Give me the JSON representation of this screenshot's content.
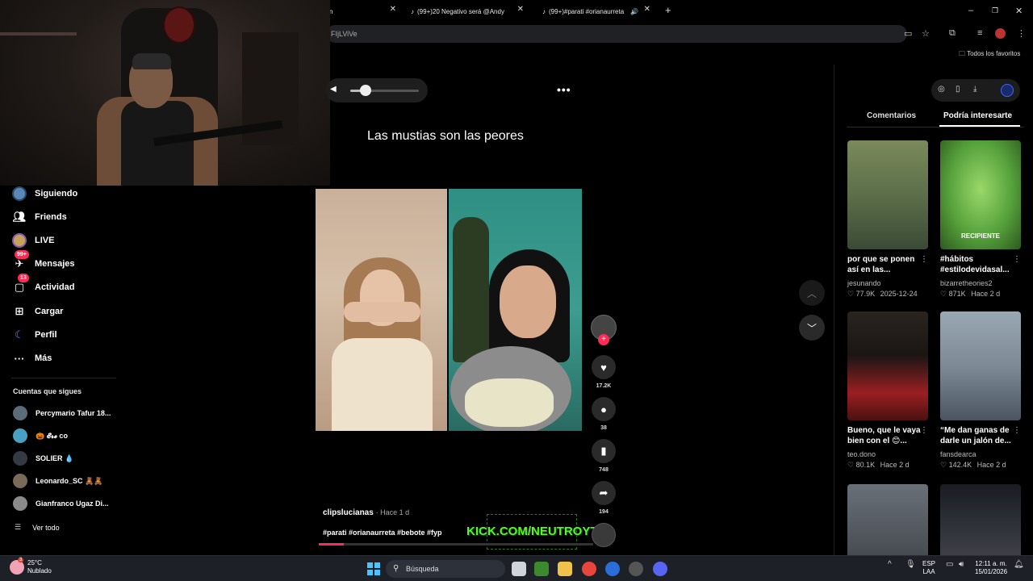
{
  "browser": {
    "tabs": [
      {
        "label": "n",
        "close": "✕"
      },
      {
        "label": "(99+)20 Negativo será @Andy",
        "close": "✕",
        "icon": "tiktok-icon"
      },
      {
        "label": "(99+)#parati #orianaurreta",
        "close": "✕",
        "icon": "tiktok-icon",
        "audio": "🔊"
      }
    ],
    "new_tab": "+",
    "url": "FIjLViVe",
    "bookmarks_label": "Todos los favoritos"
  },
  "sidebar": {
    "items": [
      {
        "label": "Siguiendo",
        "icon": "following-avatar-icon"
      },
      {
        "label": "Friends",
        "icon": "friends-icon"
      },
      {
        "label": "LIVE",
        "icon": "live-icon"
      },
      {
        "label": "Mensajes",
        "icon": "messages-icon",
        "badge": "99+"
      },
      {
        "label": "Actividad",
        "icon": "activity-icon",
        "badge": "13"
      },
      {
        "label": "Cargar",
        "icon": "upload-icon"
      },
      {
        "label": "Perfil",
        "icon": "profile-icon"
      },
      {
        "label": "Más",
        "icon": "more-icon"
      }
    ],
    "following_title": "Cuentas que sigues",
    "following": [
      {
        "name": "Percymario Tafur 18...",
        "color": "#5b6b7a"
      },
      {
        "name": "🎃 𝓔𝓻𝓮 co",
        "color": "#4aa0c0"
      },
      {
        "name": "SOLIER 💧",
        "color": "#333a44"
      },
      {
        "name": "Leonardo_SC 🧸🧸",
        "color": "#7a6a5a"
      },
      {
        "name": "Gianfranco Ugaz Di...",
        "color": "#8a8a8a"
      }
    ],
    "see_all": "Ver todo"
  },
  "video": {
    "caption": "Las mustias son las peores",
    "volume_fraction": 0.22,
    "more": "•••",
    "author": "clipslucianas",
    "time_ago": "· Hace 1 d",
    "hashtags": "#parati #orianaurreta #bebote #fyp",
    "progress_fraction": 0.09,
    "overlay_text": "KICK.COM/NEUTROYT",
    "actions": {
      "likes": "17.2K",
      "comments": "38",
      "saves": "748",
      "shares": "194"
    }
  },
  "panel": {
    "tab_comments": "Comentarios",
    "tab_related": "Podría interesarte",
    "cards": [
      {
        "title": "por que se ponen así en las...",
        "author": "jesunando",
        "likes": "♡ 77.9K",
        "date": "2025-12-24",
        "thumb": "#5c6f4a"
      },
      {
        "title": "#hábitos #estilodevidasal...",
        "author": "bizarretheories2",
        "likes": "♡ 871K",
        "date": "Hace 2 d",
        "thumb": "#57a23c",
        "label": "RECIPIENTE"
      },
      {
        "title": "Bueno, que le vaya bien con el 😊...",
        "author": "teo.dono",
        "likes": "♡ 80.1K",
        "date": "Hace 2 d",
        "thumb": "#9a1f22"
      },
      {
        "title": "“Me dan ganas de darle un jalón de...",
        "author": "fansdearca",
        "likes": "♡ 142.4K",
        "date": "Hace 2 d",
        "thumb": "#7d8a96"
      },
      {
        "title": "",
        "author": "",
        "likes": "",
        "date": "",
        "thumb": "#4a4f55"
      },
      {
        "title": "",
        "author": "",
        "likes": "",
        "date": "",
        "thumb": "#3a3d44"
      }
    ]
  },
  "taskbar": {
    "weather_temp": "25°C",
    "weather_desc": "Nublado",
    "weather_badge": "3",
    "search_placeholder": "Búsqueda",
    "lang_1": "ESP",
    "lang_2": "LAA",
    "time": "12:11 a. m.",
    "date": "15/01/2026"
  },
  "colors": {
    "tiktok_red": "#fe2c55",
    "kick_green": "#53fc18",
    "windows_blue": "#4cc2ff"
  }
}
